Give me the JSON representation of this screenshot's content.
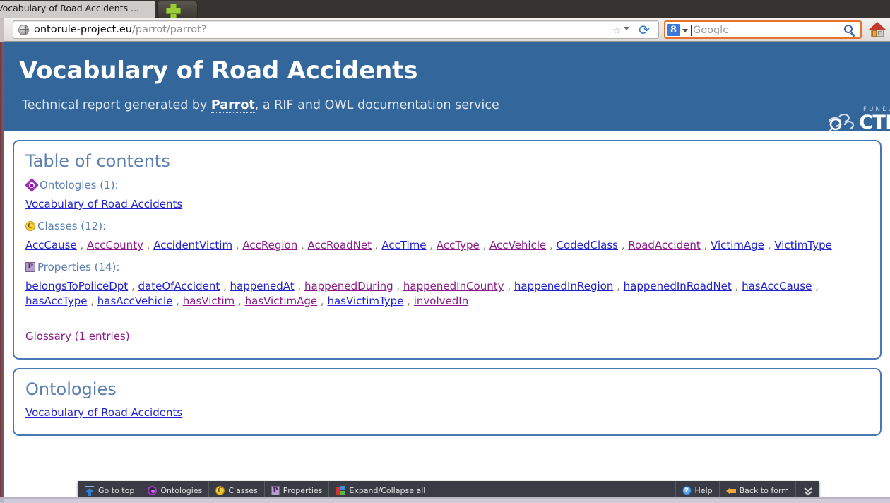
{
  "browser": {
    "tab_title": "Vocabulary of Road Accidents ...",
    "new_tab_icon": "plus-icon",
    "url_host": "ontorule-project.eu",
    "url_path": "/parrot/parrot?",
    "star_icon": "☆",
    "reload_icon": "⟳",
    "search_engine_badge": "8",
    "search_placeholder": "Google",
    "search_icon": "magnifier-icon",
    "home_icon": "home-icon"
  },
  "banner": {
    "title": "Vocabulary of Road Accidents",
    "subtitle_before": "Technical report generated by ",
    "subtitle_link": "Parrot",
    "subtitle_after": ", a RIF and OWL documentation service",
    "logo_small": "FUNDACIÓN",
    "logo_word": "CTIC",
    "bg_color": "#33669a"
  },
  "toc": {
    "title": "Table of contents",
    "groups": [
      {
        "icon": "ontology-diamond-icon",
        "label": "Ontologies (1):",
        "links": [
          {
            "text": "Vocabulary of Road Accidents",
            "state": "blue"
          }
        ]
      },
      {
        "icon": "class-circle-icon",
        "icon_glyph": "C",
        "label": "Classes (12):",
        "links": [
          {
            "text": "AccCause",
            "state": "blue"
          },
          {
            "text": "AccCounty",
            "state": "purple"
          },
          {
            "text": "AccidentVictim",
            "state": "blue"
          },
          {
            "text": "AccRegion",
            "state": "purple"
          },
          {
            "text": "AccRoadNet",
            "state": "purple"
          },
          {
            "text": "AccTime",
            "state": "blue"
          },
          {
            "text": "AccType",
            "state": "purple"
          },
          {
            "text": "AccVehicle",
            "state": "purple"
          },
          {
            "text": "CodedClass",
            "state": "blue"
          },
          {
            "text": "RoadAccident",
            "state": "purple"
          },
          {
            "text": "VictimAge",
            "state": "blue"
          },
          {
            "text": "VictimType",
            "state": "blue"
          }
        ]
      },
      {
        "icon": "property-square-icon",
        "icon_glyph": "P",
        "label": "Properties (14):",
        "links": [
          {
            "text": "belongsToPoliceDpt",
            "state": "blue"
          },
          {
            "text": "dateOfAccident",
            "state": "blue"
          },
          {
            "text": "happenedAt",
            "state": "blue"
          },
          {
            "text": "happenedDuring",
            "state": "purple"
          },
          {
            "text": "happenedInCounty",
            "state": "purple"
          },
          {
            "text": "happenedInRegion",
            "state": "blue"
          },
          {
            "text": "happenedInRoadNet",
            "state": "blue"
          },
          {
            "text": "hasAccCause",
            "state": "blue"
          },
          {
            "text": "hasAccType",
            "state": "blue"
          },
          {
            "text": "hasAccVehicle",
            "state": "blue"
          },
          {
            "text": "hasVictim",
            "state": "purple"
          },
          {
            "text": "hasVictimAge",
            "state": "purple"
          },
          {
            "text": "hasVictimType",
            "state": "blue"
          },
          {
            "text": "involvedIn",
            "state": "purple"
          }
        ]
      }
    ],
    "glossary_link": "Glossary (1 entries)",
    "glossary_state": "purple",
    "separator": ","
  },
  "ontologies_section": {
    "title": "Ontologies",
    "links": [
      {
        "text": "Vocabulary of Road Accidents",
        "state": "blue"
      }
    ]
  },
  "footer_toolbar": {
    "left_buttons": [
      {
        "icon": "arrow-up-to-bar-icon",
        "label": "Go to top"
      },
      {
        "icon": "ontology-circle-icon",
        "label": "Ontologies"
      },
      {
        "icon": "class-circle-icon",
        "glyph": "C",
        "label": "Classes"
      },
      {
        "icon": "property-square-icon",
        "glyph": "P",
        "label": "Properties"
      },
      {
        "icon": "expand-collapse-blocks-icon",
        "label": "Expand/Collapse all"
      }
    ],
    "right_buttons": [
      {
        "icon": "help-circle-icon",
        "glyph": "?",
        "label": "Help"
      },
      {
        "icon": "arrow-left-icon",
        "label": "Back to form"
      }
    ],
    "collapse_icon": "⌄⌄",
    "bg_color": "#393c45"
  }
}
